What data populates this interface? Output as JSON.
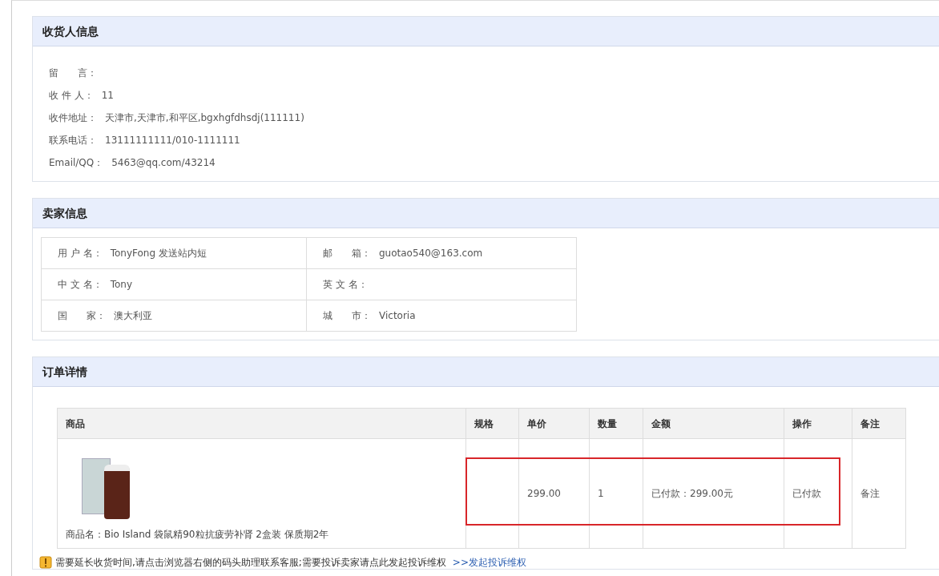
{
  "recipient": {
    "title": "收货人信息",
    "fields": [
      {
        "label": "留　　言："
      },
      {
        "label": "收 件 人：",
        "value": "11"
      },
      {
        "label": "收件地址：",
        "value": "天津市,天津市,和平区,bgxhgfdhsdj(111111)"
      },
      {
        "label": "联系电话：",
        "value": "13111111111/010-1111111"
      },
      {
        "label": "Email/QQ：",
        "value": "5463@qq.com/43214"
      }
    ]
  },
  "seller": {
    "title": "卖家信息",
    "rows": [
      [
        {
          "label": "用 户 名：",
          "value": "TonyFong 发送站内短"
        },
        {
          "label": "邮　　箱：",
          "value": "guotao540@163.com"
        }
      ],
      [
        {
          "label": "中 文 名：",
          "value": "Tony"
        },
        {
          "label": "英 文 名："
        }
      ],
      [
        {
          "label": "国　　家：",
          "value": "澳大利亚"
        },
        {
          "label": "城　　市：",
          "value": "Victoria"
        }
      ]
    ]
  },
  "order": {
    "title": "订单详情",
    "columns": [
      "商品",
      "规格",
      "单价",
      "数量",
      "金额",
      "操作",
      "备注"
    ],
    "rows": [
      {
        "product_name": "商品名：Bio Island 袋鼠精90粒抗疲劳补肾 2盒装 保质期2年",
        "unit_price": "299.00",
        "quantity": "1",
        "amount": "已付款：299.00元",
        "action": "已付款",
        "note": "备注"
      }
    ],
    "notice": "需要延长收货时间,请点击浏览器右侧的码头助理联系客服;需要投诉卖家请点此发起投诉维权",
    "notice_link": ">>发起投诉维权"
  }
}
